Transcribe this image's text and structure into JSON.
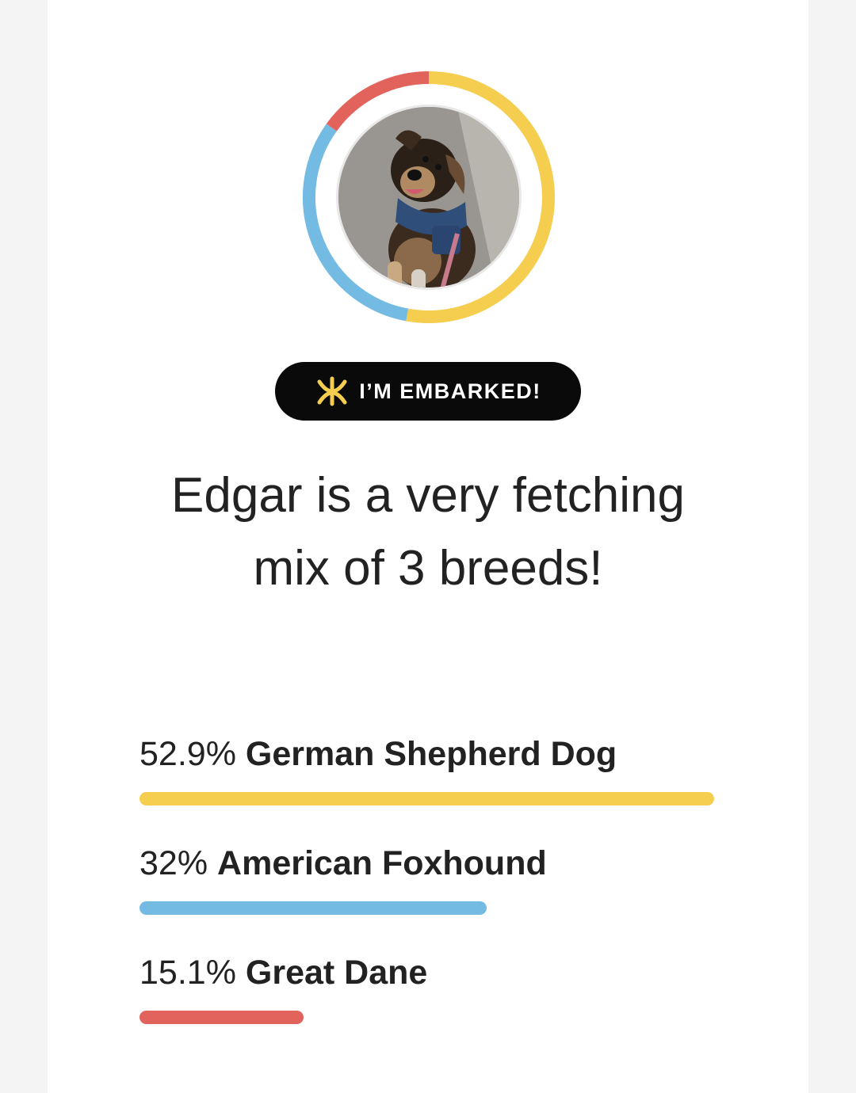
{
  "colors": {
    "german_shepherd": "#f5ce4f",
    "american_foxhound": "#74bbe3",
    "great_dane": "#e2635b",
    "badge_bg": "#0a0a0a",
    "badge_icon": "#f5ce4f"
  },
  "profile": {
    "photo_icon": "dog-photo",
    "badge_icon": "dog-bone-icon",
    "badge_label": "I’M EMBARKED!",
    "headline": "Edgar is a very fetching mix of 3 breeds!"
  },
  "breeds": [
    {
      "percent_text": "52.9%",
      "name": "German Shepherd Dog",
      "percent": 52.9,
      "color": "#f5ce4f"
    },
    {
      "percent_text": "32%",
      "name": "American Foxhound",
      "percent": 32,
      "color": "#74bbe3"
    },
    {
      "percent_text": "15.1%",
      "name": "Great Dane",
      "percent": 15.1,
      "color": "#e2635b"
    }
  ]
}
